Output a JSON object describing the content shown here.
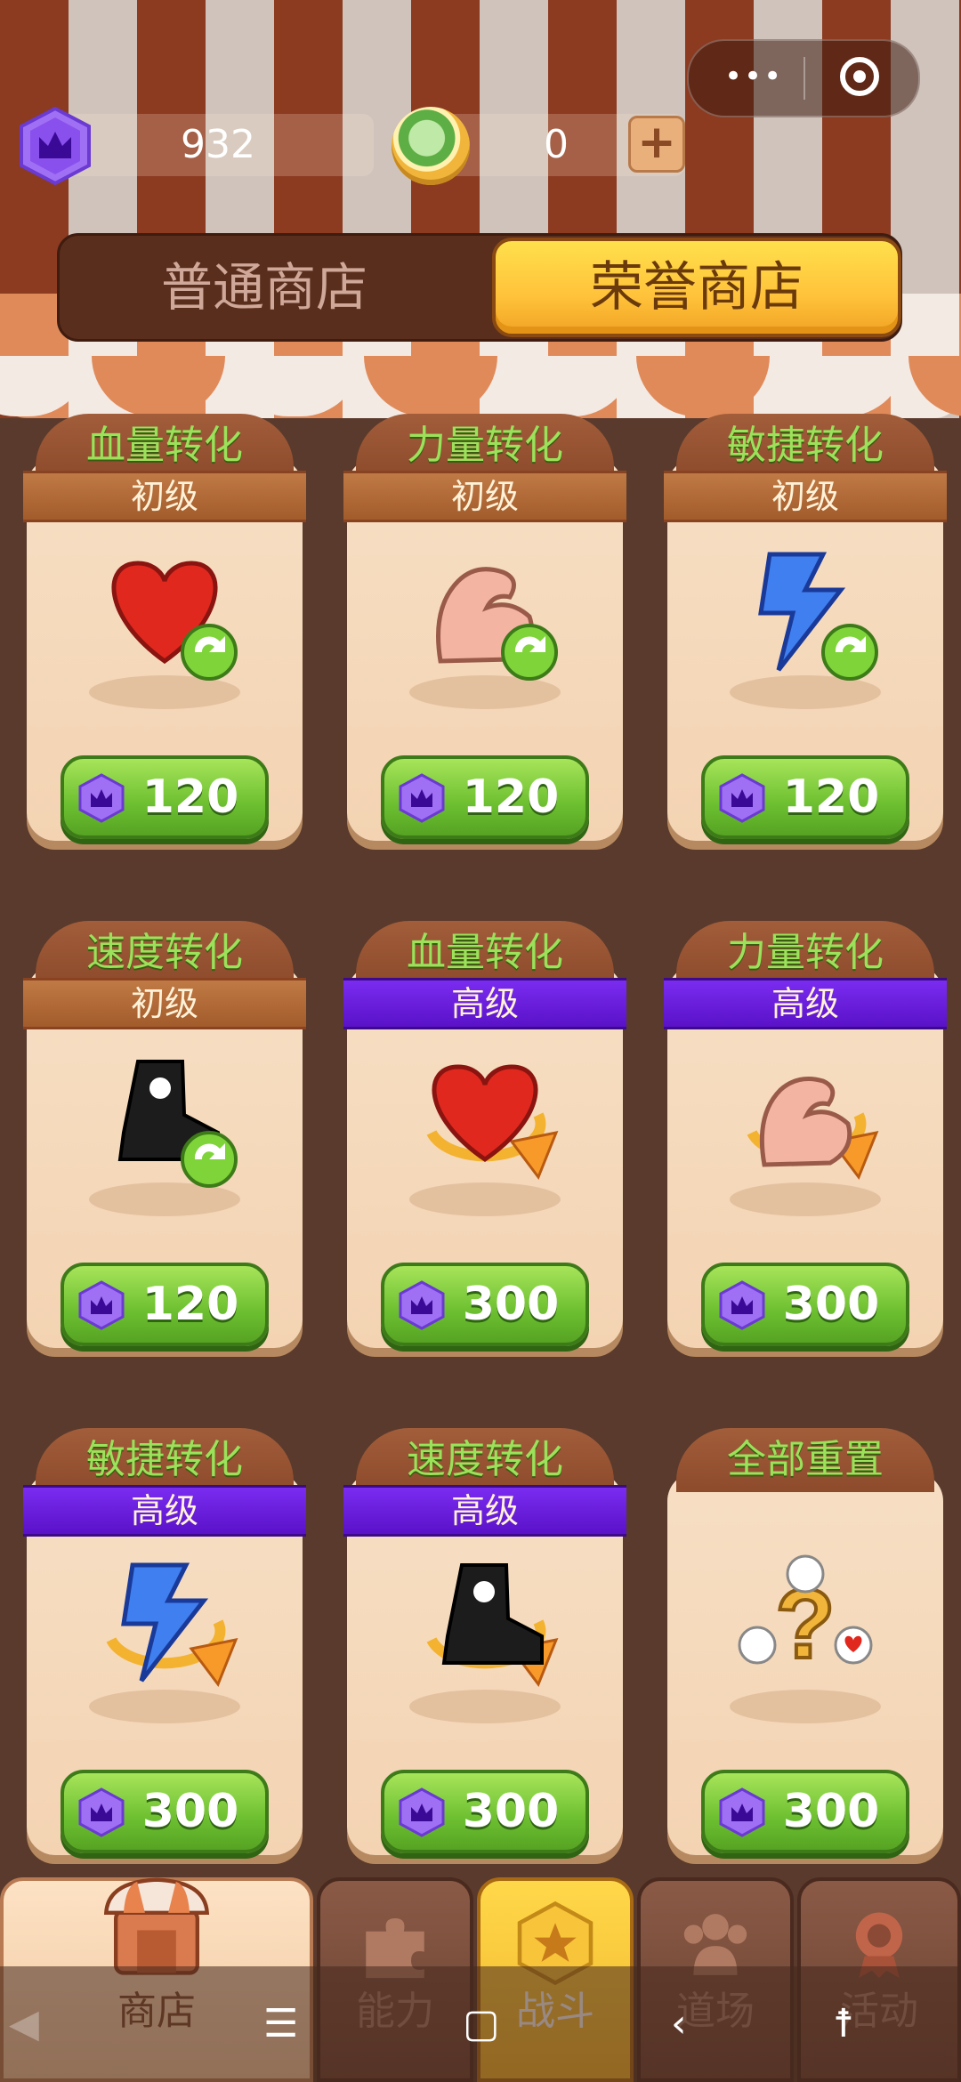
{
  "header": {
    "honor_points": "932",
    "coins": "0",
    "plus_label": "+"
  },
  "capsule": {
    "more": "•••"
  },
  "tabs": {
    "normal": "普通商店",
    "honor": "荣誉商店",
    "active": "honor"
  },
  "items": [
    {
      "title": "血量转化",
      "tier": "初级",
      "tier_type": "basic",
      "price": "120",
      "art": "heart-swap-icon"
    },
    {
      "title": "力量转化",
      "tier": "初级",
      "tier_type": "basic",
      "price": "120",
      "art": "arm-swap-icon"
    },
    {
      "title": "敏捷转化",
      "tier": "初级",
      "tier_type": "basic",
      "price": "120",
      "art": "bolt-swap-icon"
    },
    {
      "title": "速度转化",
      "tier": "初级",
      "tier_type": "basic",
      "price": "120",
      "art": "boot-swap-icon"
    },
    {
      "title": "血量转化",
      "tier": "高级",
      "tier_type": "advanced",
      "price": "300",
      "art": "heart-cycle-icon"
    },
    {
      "title": "力量转化",
      "tier": "高级",
      "tier_type": "advanced",
      "price": "300",
      "art": "arm-cycle-icon"
    },
    {
      "title": "敏捷转化",
      "tier": "高级",
      "tier_type": "advanced",
      "price": "300",
      "art": "bolt-cycle-icon"
    },
    {
      "title": "速度转化",
      "tier": "高级",
      "tier_type": "advanced",
      "price": "300",
      "art": "boot-cycle-icon"
    },
    {
      "title": "全部重置",
      "tier": "",
      "tier_type": "none",
      "price": "300",
      "art": "reset-all-icon"
    }
  ],
  "nav": [
    {
      "label": "商店",
      "icon": "shop-icon",
      "active": true
    },
    {
      "label": "能力",
      "icon": "puzzle-icon",
      "active": false
    },
    {
      "label": "战斗",
      "icon": "star-badge-icon",
      "active": false
    },
    {
      "label": "道场",
      "icon": "people-icon",
      "active": false
    },
    {
      "label": "活动",
      "icon": "gear-badge-icon",
      "active": false
    }
  ],
  "colors": {
    "background": "#5a3a2c",
    "card": "#f3d3b2",
    "title_green": "#9be15a",
    "price_green": "#6cbf30",
    "advanced_purple": "#5a12c8",
    "honor_tab": "#ffc23a"
  }
}
